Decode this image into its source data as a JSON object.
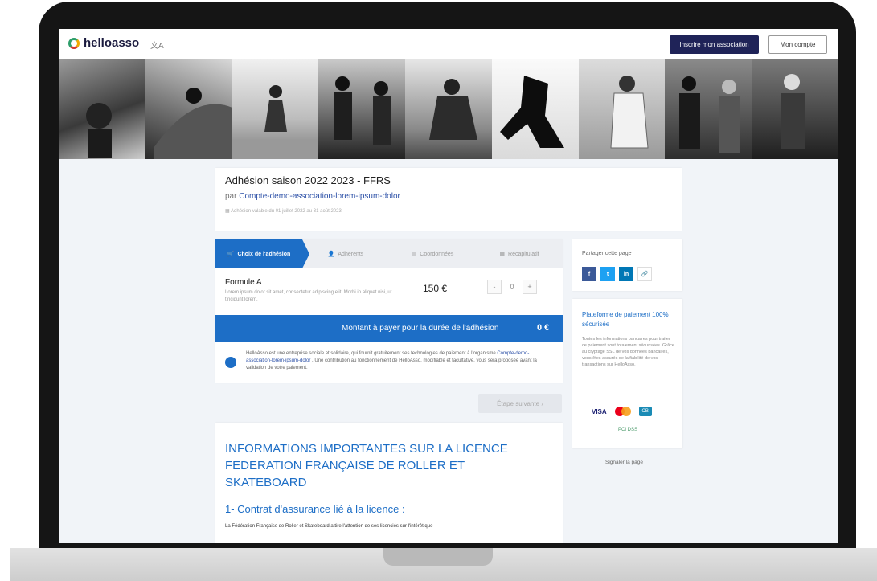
{
  "header": {
    "logo_text": "helloasso",
    "lang_icon": "translate-icon",
    "register_button": "Inscrire mon association",
    "account_button": "Mon compte"
  },
  "banner": {
    "tiles": 9
  },
  "campaign": {
    "title": "Adhésion saison 2022 2023 - FFRS",
    "by_prefix": "par",
    "organization": "Compte-demo-association-lorem-ipsum-dolor",
    "dates": "Adhésion valable du 01 juillet 2022 au 31 août 2023"
  },
  "steps": [
    {
      "label": "Choix de l'adhésion",
      "icon": "cart-icon",
      "active": true
    },
    {
      "label": "Adhérents",
      "icon": "user-icon",
      "active": false
    },
    {
      "label": "Coordonnées",
      "icon": "card-icon",
      "active": false
    },
    {
      "label": "Récapitulatif",
      "icon": "list-icon",
      "active": false
    }
  ],
  "formula": {
    "name": "Formule A",
    "description": "Lorem ipsum dolor sit amet, consectetur adipiscing elit. Morbi in aliquet nisi, ut tincidunt lorem.",
    "price": "150 €",
    "quantity": "0",
    "minus": "-",
    "plus": "+"
  },
  "total": {
    "label": "Montant à payer pour la durée de l'adhésion :",
    "value": "0 €"
  },
  "info": {
    "text_before": "HelloAsso est une entreprise sociale et solidaire, qui fournit gratuitement ses technologies de paiement à l'organisme",
    "link": "Compte-demo-association-lorem-ipsum-dolor",
    "text_after": ". Une contribution au fonctionnement de HelloAsso, modifiable et facultative, vous sera proposée avant la validation de votre paiement."
  },
  "next_button": "Étape suivante  ›",
  "content": {
    "heading": "INFORMATIONS IMPORTANTES SUR LA LICENCE FEDERATION FRANÇAISE DE ROLLER ET SKATEBOARD",
    "subheading": "1- Contrat d'assurance lié à la licence :",
    "paragraph": "La Fédération Française de Roller et Skateboard attire l'attention de ses licenciés sur l'intérêt que"
  },
  "share": {
    "title": "Partager cette page",
    "buttons": [
      {
        "label": "f",
        "icon": "facebook-icon",
        "color": "#3b5998"
      },
      {
        "label": "t",
        "icon": "twitter-icon",
        "color": "#1da1f2"
      },
      {
        "label": "in",
        "icon": "linkedin-icon",
        "color": "#0077b5"
      },
      {
        "label": "🔗",
        "icon": "link-icon",
        "color": "#ffffff"
      }
    ]
  },
  "secure": {
    "title": "Plateforme de paiement 100% sécurisée",
    "text": "Toutes les informations bancaires pour traiter ce paiement sont totalement sécurisées. Grâce au cryptage SSL de vos données bancaires, vous êtes assurés de la fiabilité de vos transactions sur HelloAsso.",
    "visa": "VISA",
    "cb": "CB",
    "small_logo": "PCI DSS"
  },
  "report_link": "Signaler la page",
  "colors": {
    "primary": "#1d6ec6",
    "dark": "#1f2358",
    "background": "#f1f4f8"
  }
}
